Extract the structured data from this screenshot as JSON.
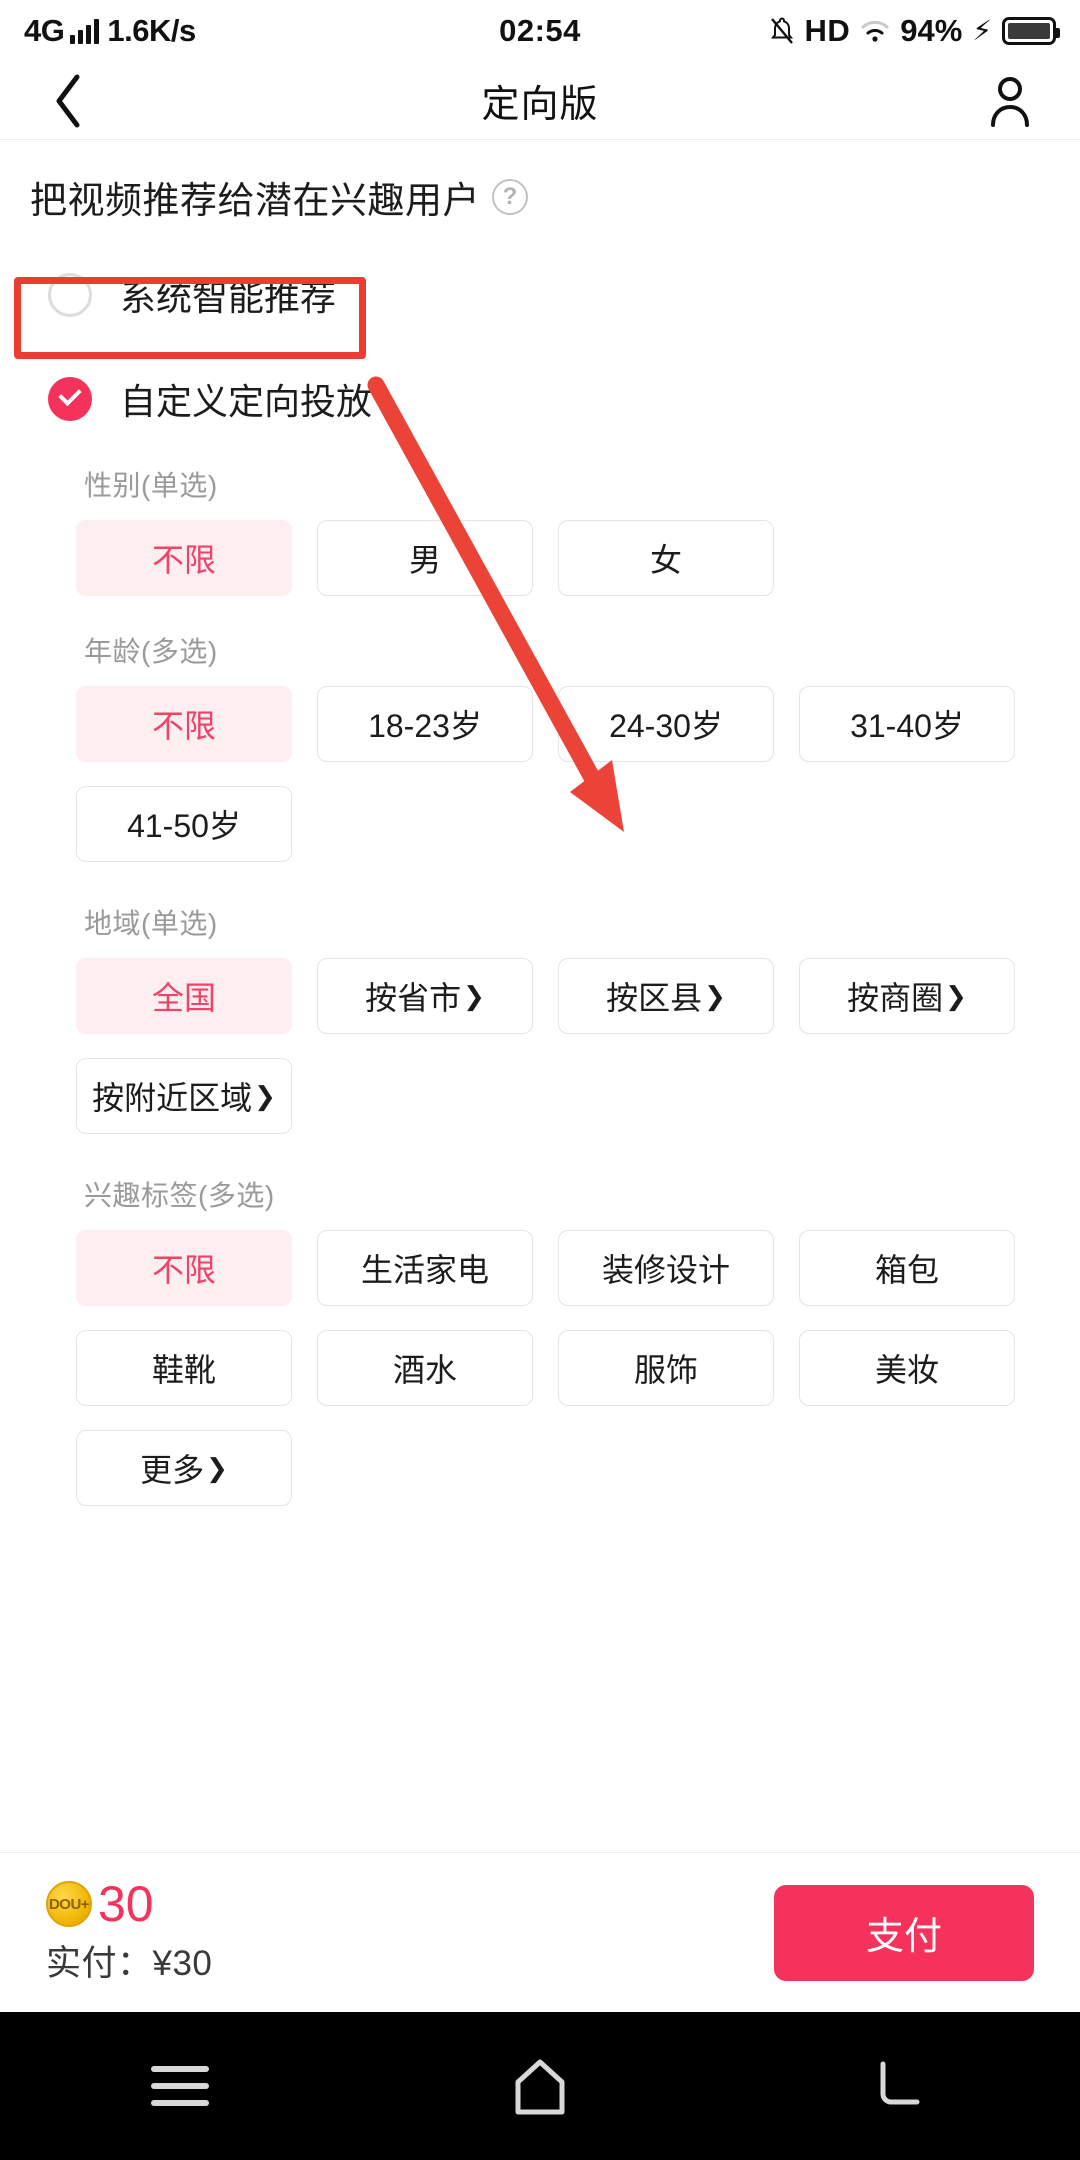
{
  "statusbar": {
    "network_type": "4G",
    "speed": "1.6K/s",
    "time": "02:54",
    "hd": "HD",
    "battery_percent": "94%",
    "icons": [
      "signal-bars-icon",
      "mute-icon",
      "wifi-icon",
      "charging-bolt-icon",
      "battery-icon"
    ]
  },
  "titlebar": {
    "back": "back-chevron-icon",
    "title": "定向版",
    "profile": "person-icon"
  },
  "lead": {
    "text": "把视频推荐给潜在兴趣用户",
    "help": "?"
  },
  "mode_options": [
    {
      "label": "系统智能推荐",
      "selected": false
    },
    {
      "label": "自定义定向投放",
      "selected": true
    }
  ],
  "sections": [
    {
      "title": "性别(单选)",
      "chips": [
        {
          "label": "不限",
          "selected": true,
          "arrow": false
        },
        {
          "label": "男",
          "selected": false,
          "arrow": false
        },
        {
          "label": "女",
          "selected": false,
          "arrow": false
        }
      ]
    },
    {
      "title": "年龄(多选)",
      "chips": [
        {
          "label": "不限",
          "selected": true,
          "arrow": false
        },
        {
          "label": "18-23岁",
          "selected": false,
          "arrow": false
        },
        {
          "label": "24-30岁",
          "selected": false,
          "arrow": false
        },
        {
          "label": "31-40岁",
          "selected": false,
          "arrow": false
        },
        {
          "label": "41-50岁",
          "selected": false,
          "arrow": false
        }
      ]
    },
    {
      "title": "地域(单选)",
      "chips": [
        {
          "label": "全国",
          "selected": true,
          "arrow": false
        },
        {
          "label": "按省市",
          "selected": false,
          "arrow": true
        },
        {
          "label": "按区县",
          "selected": false,
          "arrow": true
        },
        {
          "label": "按商圈",
          "selected": false,
          "arrow": true
        },
        {
          "label": "按附近区域",
          "selected": false,
          "arrow": true
        }
      ]
    },
    {
      "title": "兴趣标签(多选)",
      "chips": [
        {
          "label": "不限",
          "selected": true,
          "arrow": false
        },
        {
          "label": "生活家电",
          "selected": false,
          "arrow": false
        },
        {
          "label": "装修设计",
          "selected": false,
          "arrow": false
        },
        {
          "label": "箱包",
          "selected": false,
          "arrow": false
        },
        {
          "label": "鞋靴",
          "selected": false,
          "arrow": false
        },
        {
          "label": "酒水",
          "selected": false,
          "arrow": false
        },
        {
          "label": "服饰",
          "selected": false,
          "arrow": false
        },
        {
          "label": "美妆",
          "selected": false,
          "arrow": false
        },
        {
          "label": "更多",
          "selected": false,
          "arrow": true
        }
      ]
    }
  ],
  "paybar": {
    "coin_label": "DOU+",
    "amount": "30",
    "actual": "实付：¥30",
    "pay_button": "支付"
  },
  "androidnav": {
    "recents": "menu-icon",
    "home": "home-icon",
    "back": "back-arrow-icon"
  },
  "annotations": {
    "highlight_color": "#ef3c33",
    "arrow_color": "#eb4337"
  },
  "colors": {
    "accent": "#f5325b",
    "chip_selected_bg": "#fdeef0",
    "chip_selected_text": "#f0436a",
    "chip_border": "#e4e4e4",
    "section_label": "#9a9a9a"
  }
}
